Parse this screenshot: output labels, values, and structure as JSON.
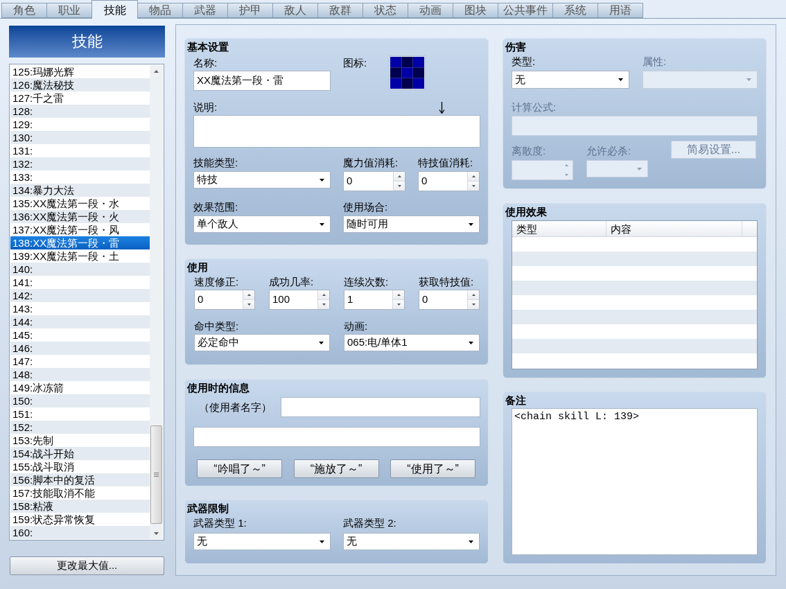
{
  "tabs": [
    {
      "label": "角色",
      "selected": false
    },
    {
      "label": "职业",
      "selected": false
    },
    {
      "label": "技能",
      "selected": true
    },
    {
      "label": "物品",
      "selected": false
    },
    {
      "label": "武器",
      "selected": false
    },
    {
      "label": "护甲",
      "selected": false
    },
    {
      "label": "敌人",
      "selected": false
    },
    {
      "label": "敌群",
      "selected": false
    },
    {
      "label": "状态",
      "selected": false
    },
    {
      "label": "动画",
      "selected": false
    },
    {
      "label": "图块",
      "selected": false
    },
    {
      "label": "公共事件",
      "selected": false
    },
    {
      "label": "系统",
      "selected": false
    },
    {
      "label": "用语",
      "selected": false
    }
  ],
  "skill_list": {
    "header": "技能",
    "items": [
      {
        "label": "125:玛娜光辉",
        "selected": false
      },
      {
        "label": "126:魔法秘技",
        "selected": false
      },
      {
        "label": "127:千之雷",
        "selected": false
      },
      {
        "label": "128:",
        "selected": false
      },
      {
        "label": "129:",
        "selected": false
      },
      {
        "label": "130:",
        "selected": false
      },
      {
        "label": "131:",
        "selected": false
      },
      {
        "label": "132:",
        "selected": false
      },
      {
        "label": "133:",
        "selected": false
      },
      {
        "label": "134:暴力大法",
        "selected": false
      },
      {
        "label": "135:XX魔法第一段・水",
        "selected": false
      },
      {
        "label": "136:XX魔法第一段・火",
        "selected": false
      },
      {
        "label": "137:XX魔法第一段・风",
        "selected": false
      },
      {
        "label": "138:XX魔法第一段・雷",
        "selected": true
      },
      {
        "label": "139:XX魔法第一段・土",
        "selected": false
      },
      {
        "label": "140:",
        "selected": false
      },
      {
        "label": "141:",
        "selected": false
      },
      {
        "label": "142:",
        "selected": false
      },
      {
        "label": "143:",
        "selected": false
      },
      {
        "label": "144:",
        "selected": false
      },
      {
        "label": "145:",
        "selected": false
      },
      {
        "label": "146:",
        "selected": false
      },
      {
        "label": "147:",
        "selected": false
      },
      {
        "label": "148:",
        "selected": false
      },
      {
        "label": "149:冰冻箭",
        "selected": false
      },
      {
        "label": "150:",
        "selected": false
      },
      {
        "label": "151:",
        "selected": false
      },
      {
        "label": "152:",
        "selected": false
      },
      {
        "label": "153:先制",
        "selected": false
      },
      {
        "label": "154:战斗开始",
        "selected": false
      },
      {
        "label": "155:战斗取消",
        "selected": false
      },
      {
        "label": "156:脚本中的复活",
        "selected": false
      },
      {
        "label": "157:技能取消不能",
        "selected": false
      },
      {
        "label": "158:粘液",
        "selected": false
      },
      {
        "label": "159:状态异常恢复",
        "selected": false
      },
      {
        "label": "160:",
        "selected": false
      }
    ],
    "change_max_button": "更改最大值..."
  },
  "basic_settings": {
    "title": "基本设置",
    "name": {
      "label": "名称:",
      "value": "XX魔法第一段・雷"
    },
    "icon": {
      "label": "图标:"
    },
    "description": {
      "label": "说明:"
    },
    "skill_type": {
      "label": "技能类型:",
      "value": "特技"
    },
    "mp_cost": {
      "label": "魔力值消耗:",
      "value": "0"
    },
    "tp_cost": {
      "label": "特技值消耗:",
      "value": "0"
    },
    "scope": {
      "label": "效果范围:",
      "value": "单个敌人"
    },
    "occasion": {
      "label": "使用场合:",
      "value": "随时可用"
    }
  },
  "invocation": {
    "title": "使用",
    "speed": {
      "label": "速度修正:",
      "value": "0"
    },
    "success": {
      "label": "成功几率:",
      "value": "100"
    },
    "repeats": {
      "label": "连续次数:",
      "value": "1"
    },
    "tp_gain": {
      "label": "获取特技值:",
      "value": "0"
    },
    "hit_type": {
      "label": "命中类型:",
      "value": "必定命中"
    },
    "animation": {
      "label": "动画:",
      "value": "065:电/单体1"
    }
  },
  "message": {
    "title": "使用时的信息",
    "user_name_label": "（使用者名字）",
    "buttons": [
      "“吟唱了～”",
      "“施放了～”",
      "“使用了～”"
    ]
  },
  "weapon_requirements": {
    "title": "武器限制",
    "weapon_type_1": {
      "label": "武器类型 1:",
      "value": "无"
    },
    "weapon_type_2": {
      "label": "武器类型 2:",
      "value": "无"
    }
  },
  "damage": {
    "title": "伤害",
    "type": {
      "label": "类型:",
      "value": "无",
      "disabled": false
    },
    "element": {
      "label": "属性:",
      "disabled": true
    },
    "formula": {
      "label": "计算公式:",
      "disabled": true
    },
    "variance": {
      "label": "离散度:",
      "disabled": true
    },
    "critical": {
      "label": "允许必杀:",
      "disabled": true
    },
    "quick_setup": {
      "label": "简易设置...",
      "disabled": true
    }
  },
  "effects": {
    "title": "使用效果",
    "columns": [
      "类型",
      "内容"
    ]
  },
  "note": {
    "title": "备注",
    "value": "<chain skill L: 139>"
  }
}
